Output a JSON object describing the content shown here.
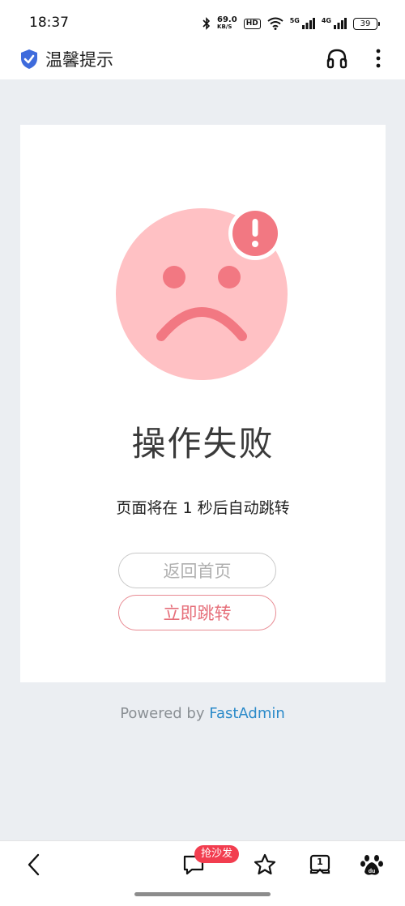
{
  "status_bar": {
    "time": "18:37",
    "net_speed_value": "69.0",
    "net_speed_unit": "KB/S",
    "hd_label": "HD",
    "network_1": "5G",
    "network_2": "4G",
    "battery": "39"
  },
  "title_bar": {
    "title": "温馨提示",
    "shield_color": "#3e6bdc"
  },
  "main": {
    "result_title": "操作失败",
    "countdown_text": "页面将在 1 秒后自动跳转",
    "home_button_label": "返回首页",
    "jump_button_label": "立即跳转",
    "icon": "sad-face-icon",
    "face_color": "#ffc1c4",
    "accent_color": "#f27882"
  },
  "footer": {
    "powered_prefix": "Powered by",
    "powered_link": "FastAdmin"
  },
  "bottom_nav": {
    "sofa_badge": "抢沙发",
    "tabs_count": "1"
  }
}
